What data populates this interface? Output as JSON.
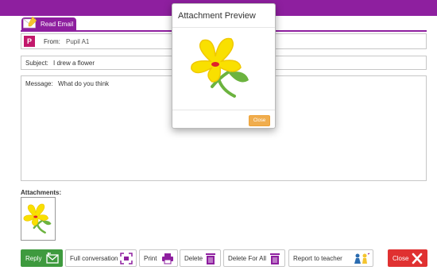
{
  "tab": {
    "label": "Read Email",
    "icon": "envelope-pencil-icon"
  },
  "from": {
    "avatar_letter": "P",
    "label": "From:",
    "value": "Pupil A1"
  },
  "subject": {
    "label": "Subject:",
    "value": "I drew a flower"
  },
  "message": {
    "label": "Message:",
    "value": "What do you think"
  },
  "attachments": {
    "label": "Attachments:"
  },
  "buttons": {
    "reply": "Reply",
    "full_conversation": "Full conversation",
    "print": "Print",
    "delete": "Delete",
    "delete_for_all": "Delete For All",
    "report": "Report to teacher",
    "close": "Close"
  },
  "modal": {
    "title": "Attachment Preview",
    "close_label": "Close"
  },
  "colors": {
    "brand": "#8e1f9f",
    "reply": "#3e9a3e",
    "close": "#e03131",
    "modal_close": "#f0ad4e",
    "avatar": "#c2186b"
  }
}
